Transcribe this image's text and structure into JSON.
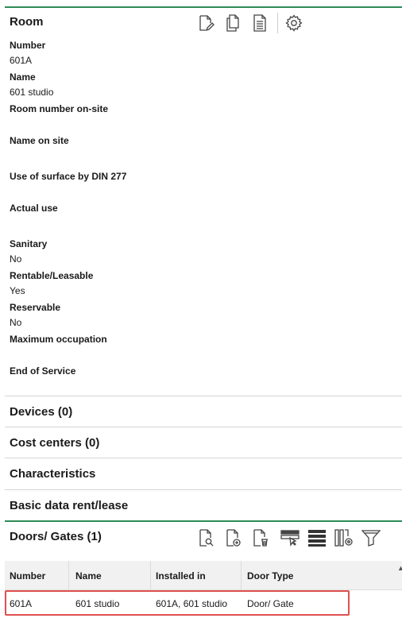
{
  "room": {
    "title": "Room",
    "toolbar": [
      {
        "icon": "edit-document-icon"
      },
      {
        "icon": "copy-icon"
      },
      {
        "icon": "document-icon"
      },
      {
        "icon": "gear-icon"
      }
    ],
    "fields": {
      "number_label": "Number",
      "number_value": "601A",
      "name_label": "Name",
      "name_value": "601 studio",
      "room_on_site_label": "Room number on-site",
      "name_on_site_label": "Name on site",
      "surface_label": "Use of surface by DIN 277",
      "actual_use_label": "Actual use",
      "sanitary_label": "Sanitary",
      "sanitary_value": "No",
      "rentable_label": "Rentable/Leasable",
      "rentable_value": "Yes",
      "reservable_label": "Reservable",
      "reservable_value": "No",
      "max_occ_label": "Maximum occupation",
      "end_service_label": "End of Service"
    }
  },
  "sections": {
    "devices": "Devices (0)",
    "cost_centers": "Cost centers (0)",
    "characteristics": "Characteristics",
    "basic_data": "Basic data rent/lease"
  },
  "doors": {
    "title": "Doors/ Gates (1)",
    "toolbar": [
      {
        "icon": "search-document-icon"
      },
      {
        "icon": "add-document-icon"
      },
      {
        "icon": "delete-document-icon"
      },
      {
        "icon": "select-rows-icon"
      },
      {
        "icon": "list-view-icon"
      },
      {
        "icon": "column-settings-icon"
      },
      {
        "icon": "filter-icon"
      }
    ],
    "columns": [
      "Number",
      "Name",
      "Installed in",
      "Door Type"
    ],
    "rows": [
      [
        "601A",
        "601 studio",
        "601A, 601 studio",
        "Door/ Gate"
      ]
    ],
    "highlight_color": "#e05050"
  },
  "colors": {
    "accent": "#2e8b57"
  }
}
